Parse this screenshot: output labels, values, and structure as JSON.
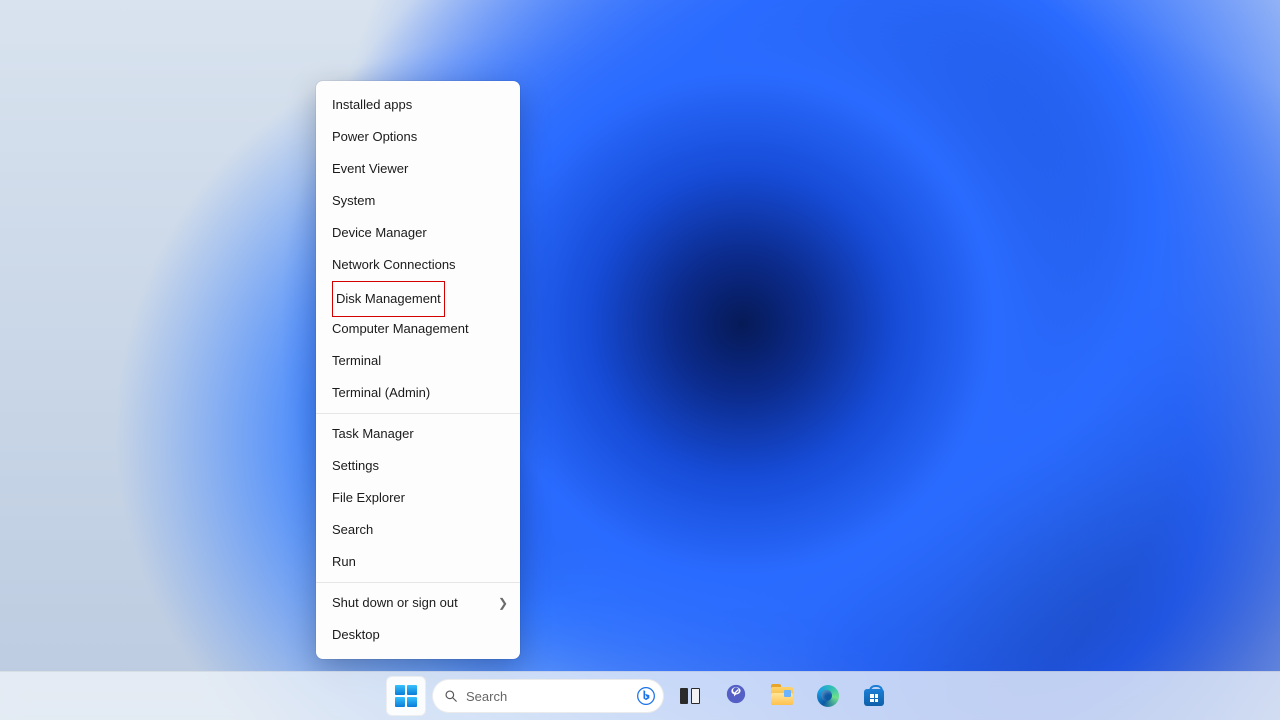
{
  "winx_menu": {
    "groups": [
      {
        "items": [
          {
            "label": "Installed apps",
            "submenu": false,
            "highlighted": false
          },
          {
            "label": "Power Options",
            "submenu": false,
            "highlighted": false
          },
          {
            "label": "Event Viewer",
            "submenu": false,
            "highlighted": false
          },
          {
            "label": "System",
            "submenu": false,
            "highlighted": false
          },
          {
            "label": "Device Manager",
            "submenu": false,
            "highlighted": false
          },
          {
            "label": "Network Connections",
            "submenu": false,
            "highlighted": false
          },
          {
            "label": "Disk Management",
            "submenu": false,
            "highlighted": true
          },
          {
            "label": "Computer Management",
            "submenu": false,
            "highlighted": false
          },
          {
            "label": "Terminal",
            "submenu": false,
            "highlighted": false
          },
          {
            "label": "Terminal (Admin)",
            "submenu": false,
            "highlighted": false
          }
        ]
      },
      {
        "items": [
          {
            "label": "Task Manager",
            "submenu": false,
            "highlighted": false
          },
          {
            "label": "Settings",
            "submenu": false,
            "highlighted": false
          },
          {
            "label": "File Explorer",
            "submenu": false,
            "highlighted": false
          },
          {
            "label": "Search",
            "submenu": false,
            "highlighted": false
          },
          {
            "label": "Run",
            "submenu": false,
            "highlighted": false
          }
        ]
      },
      {
        "items": [
          {
            "label": "Shut down or sign out",
            "submenu": true,
            "highlighted": false
          },
          {
            "label": "Desktop",
            "submenu": false,
            "highlighted": false
          }
        ]
      }
    ]
  },
  "taskbar": {
    "search_placeholder": "Search",
    "items": [
      {
        "name": "start",
        "active": true
      },
      {
        "name": "search"
      },
      {
        "name": "task-view"
      },
      {
        "name": "chat"
      },
      {
        "name": "file-explorer"
      },
      {
        "name": "edge"
      },
      {
        "name": "microsoft-store"
      }
    ]
  },
  "colors": {
    "menu_bg": "#fdfdfd",
    "highlight_border": "#d40000",
    "taskbar_bg": "rgba(238,243,249,.78)"
  }
}
